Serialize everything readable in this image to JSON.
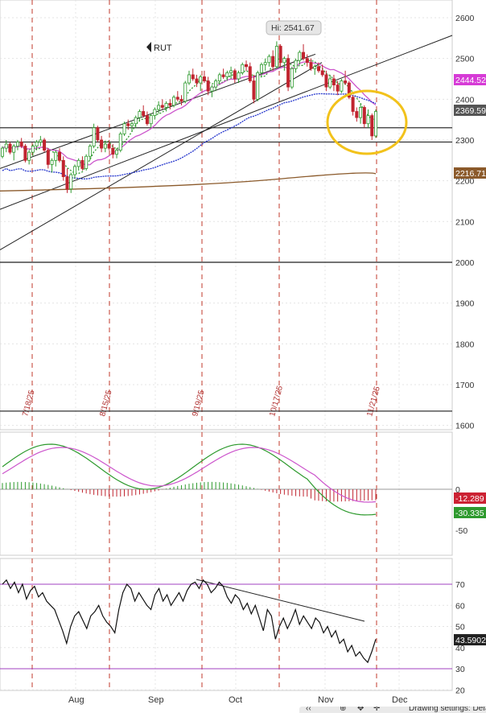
{
  "chart_data": [
    {
      "type": "candlestick",
      "title": "RUT",
      "high_label": "Hi: 2541.67",
      "y_axis_ticks": [
        "2600",
        "2500",
        "2400",
        "2300",
        "2200",
        "2100",
        "2000",
        "1900",
        "1800",
        "1700",
        "1600"
      ],
      "x_axis_ticks": [
        "Aug",
        "Sep",
        "Oct",
        "Nov",
        "Dec"
      ],
      "event_dates": [
        "7/18/25",
        "8/15/25",
        "9/19/25",
        "10/17/25",
        "11/21/25"
      ],
      "horizontal_levels": [
        2330,
        2295,
        2000,
        1635
      ],
      "price_labels": [
        {
          "text": "2444.52",
          "color": "#d63bd6"
        },
        {
          "text": "2369.59",
          "color": "#555555"
        },
        {
          "text": "2216.71",
          "color": "#8b5a2b"
        }
      ],
      "series": [
        {
          "name": "MA fast (green)",
          "color": "#2e9a2e"
        },
        {
          "name": "MA (magenta)",
          "color": "#cc55cc"
        },
        {
          "name": "MA (blue)",
          "color": "#2233cc"
        },
        {
          "name": "MA (brown)",
          "color": "#8b5a2b"
        }
      ],
      "candles": [
        [
          2260,
          2285,
          2255,
          2280
        ],
        [
          2280,
          2300,
          2270,
          2290
        ],
        [
          2290,
          2295,
          2265,
          2270
        ],
        [
          2270,
          2290,
          2250,
          2285
        ],
        [
          2285,
          2300,
          2275,
          2295
        ],
        [
          2295,
          2305,
          2280,
          2285
        ],
        [
          2285,
          2290,
          2245,
          2250
        ],
        [
          2250,
          2275,
          2240,
          2270
        ],
        [
          2270,
          2290,
          2260,
          2285
        ],
        [
          2285,
          2300,
          2275,
          2295
        ],
        [
          2295,
          2310,
          2285,
          2300
        ],
        [
          2300,
          2305,
          2270,
          2275
        ],
        [
          2275,
          2280,
          2230,
          2240
        ],
        [
          2240,
          2255,
          2220,
          2250
        ],
        [
          2250,
          2275,
          2235,
          2270
        ],
        [
          2270,
          2280,
          2245,
          2250
        ],
        [
          2250,
          2260,
          2200,
          2210
        ],
        [
          2210,
          2230,
          2170,
          2180
        ],
        [
          2180,
          2220,
          2170,
          2215
        ],
        [
          2215,
          2240,
          2205,
          2235
        ],
        [
          2235,
          2255,
          2225,
          2250
        ],
        [
          2250,
          2260,
          2225,
          2230
        ],
        [
          2230,
          2265,
          2225,
          2260
        ],
        [
          2260,
          2290,
          2250,
          2285
        ],
        [
          2285,
          2340,
          2280,
          2330
        ],
        [
          2330,
          2335,
          2295,
          2300
        ],
        [
          2300,
          2310,
          2270,
          2280
        ],
        [
          2280,
          2295,
          2270,
          2290
        ],
        [
          2290,
          2300,
          2275,
          2280
        ],
        [
          2280,
          2290,
          2255,
          2265
        ],
        [
          2265,
          2280,
          2255,
          2275
        ],
        [
          2275,
          2320,
          2270,
          2315
        ],
        [
          2315,
          2345,
          2310,
          2340
        ],
        [
          2340,
          2350,
          2325,
          2335
        ],
        [
          2335,
          2345,
          2320,
          2340
        ],
        [
          2340,
          2360,
          2330,
          2355
        ],
        [
          2355,
          2375,
          2345,
          2370
        ],
        [
          2370,
          2385,
          2355,
          2360
        ],
        [
          2360,
          2370,
          2335,
          2340
        ],
        [
          2340,
          2365,
          2330,
          2360
        ],
        [
          2360,
          2380,
          2350,
          2375
        ],
        [
          2375,
          2395,
          2365,
          2385
        ],
        [
          2385,
          2400,
          2375,
          2380
        ],
        [
          2380,
          2395,
          2370,
          2390
        ],
        [
          2390,
          2400,
          2375,
          2385
        ],
        [
          2385,
          2410,
          2380,
          2405
        ],
        [
          2405,
          2420,
          2395,
          2400
        ],
        [
          2400,
          2410,
          2385,
          2395
        ],
        [
          2395,
          2445,
          2390,
          2440
        ],
        [
          2440,
          2470,
          2435,
          2460
        ],
        [
          2460,
          2475,
          2445,
          2450
        ],
        [
          2450,
          2460,
          2430,
          2440
        ],
        [
          2440,
          2460,
          2420,
          2455
        ],
        [
          2455,
          2470,
          2440,
          2445
        ],
        [
          2445,
          2455,
          2410,
          2420
        ],
        [
          2420,
          2435,
          2405,
          2430
        ],
        [
          2430,
          2450,
          2420,
          2445
        ],
        [
          2445,
          2465,
          2435,
          2460
        ],
        [
          2460,
          2475,
          2450,
          2455
        ],
        [
          2455,
          2470,
          2445,
          2465
        ],
        [
          2465,
          2480,
          2450,
          2470
        ],
        [
          2470,
          2475,
          2440,
          2450
        ],
        [
          2450,
          2470,
          2440,
          2465
        ],
        [
          2465,
          2490,
          2460,
          2485
        ],
        [
          2485,
          2495,
          2470,
          2480
        ],
        [
          2480,
          2490,
          2440,
          2445
        ],
        [
          2445,
          2460,
          2390,
          2400
        ],
        [
          2400,
          2470,
          2395,
          2465
        ],
        [
          2465,
          2490,
          2455,
          2485
        ],
        [
          2485,
          2500,
          2470,
          2490
        ],
        [
          2490,
          2510,
          2480,
          2505
        ],
        [
          2505,
          2520,
          2470,
          2480
        ],
        [
          2480,
          2542,
          2475,
          2530
        ],
        [
          2530,
          2535,
          2480,
          2490
        ],
        [
          2490,
          2505,
          2470,
          2500
        ],
        [
          2500,
          2510,
          2420,
          2430
        ],
        [
          2430,
          2480,
          2425,
          2475
        ],
        [
          2475,
          2500,
          2465,
          2495
        ],
        [
          2495,
          2520,
          2485,
          2515
        ],
        [
          2515,
          2535,
          2495,
          2500
        ],
        [
          2500,
          2510,
          2480,
          2490
        ],
        [
          2490,
          2500,
          2470,
          2475
        ],
        [
          2475,
          2485,
          2460,
          2480
        ],
        [
          2480,
          2490,
          2465,
          2470
        ],
        [
          2470,
          2485,
          2455,
          2460
        ],
        [
          2460,
          2470,
          2420,
          2430
        ],
        [
          2430,
          2460,
          2425,
          2450
        ],
        [
          2450,
          2460,
          2420,
          2435
        ],
        [
          2435,
          2445,
          2410,
          2420
        ],
        [
          2420,
          2450,
          2415,
          2445
        ],
        [
          2445,
          2470,
          2435,
          2440
        ],
        [
          2440,
          2445,
          2400,
          2405
        ],
        [
          2405,
          2410,
          2360,
          2370
        ],
        [
          2370,
          2380,
          2345,
          2355
        ],
        [
          2355,
          2390,
          2340,
          2380
        ],
        [
          2380,
          2385,
          2330,
          2340
        ],
        [
          2340,
          2375,
          2330,
          2360
        ],
        [
          2360,
          2365,
          2300,
          2310
        ],
        [
          2310,
          2375,
          2305,
          2370
        ]
      ]
    },
    {
      "type": "macd",
      "y_axis_ticks": [
        "0",
        "-50"
      ],
      "value_labels": [
        {
          "text": "-12.289",
          "color": "#cc2233"
        },
        {
          "text": "-30.335",
          "color": "#2e9a2e"
        }
      ]
    },
    {
      "type": "rsi",
      "y_axis_ticks": [
        "70",
        "60",
        "50",
        "40",
        "30",
        "20"
      ],
      "levels": [
        70,
        30
      ],
      "value_label": "43.5902",
      "values": [
        70,
        72,
        68,
        71,
        66,
        70,
        63,
        67,
        69,
        64,
        66,
        62,
        60,
        58,
        53,
        48,
        42,
        50,
        55,
        57,
        53,
        49,
        55,
        57,
        60,
        55,
        52,
        50,
        47,
        58,
        66,
        70,
        68,
        62,
        66,
        63,
        60,
        58,
        65,
        68,
        62,
        65,
        60,
        63,
        66,
        62,
        67,
        70,
        71,
        68,
        72,
        70,
        66,
        68,
        71,
        69,
        64,
        61,
        65,
        63,
        58,
        61,
        56,
        60,
        54,
        48,
        58,
        55,
        44,
        50,
        54,
        49,
        53,
        58,
        51,
        55,
        52,
        49,
        54,
        52,
        47,
        50,
        45,
        48,
        42,
        44,
        38,
        41,
        36,
        38,
        35,
        33,
        38,
        44
      ]
    }
  ],
  "toolbar": {
    "label": "Drawing settings: Default"
  }
}
